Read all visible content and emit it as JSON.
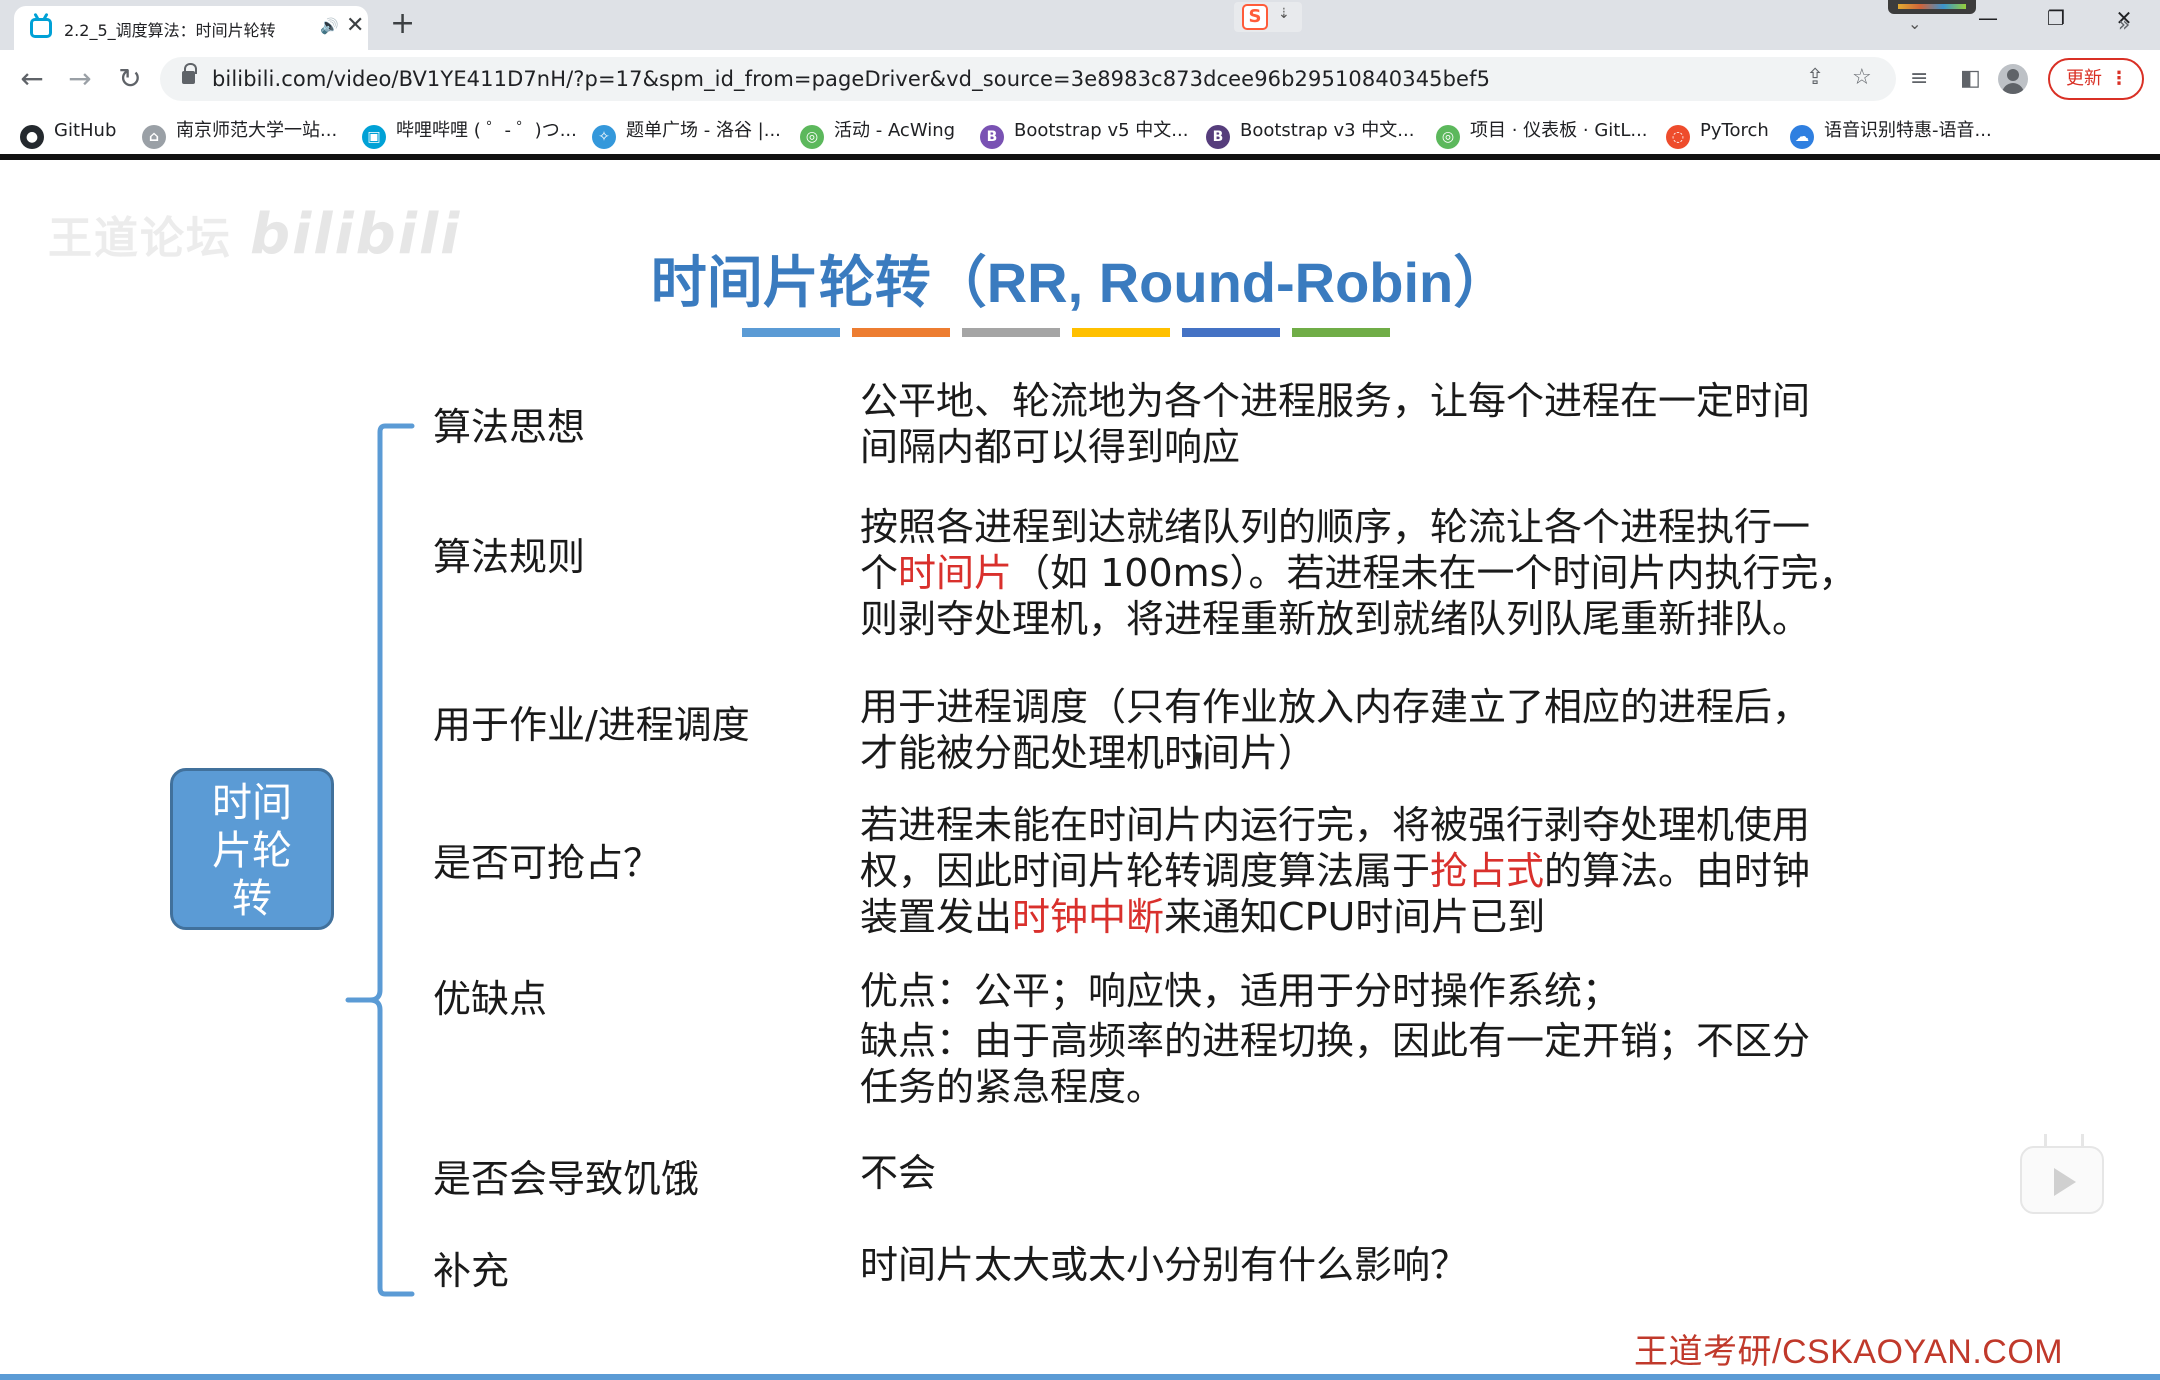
{
  "browser": {
    "tab": {
      "title": "2.2_5_调度算法：时间片轮转",
      "audio_icon": "🔊",
      "close_icon": "✕"
    },
    "new_tab_icon": "+",
    "ext_s_label": "S",
    "window": {
      "minimize": "—",
      "restore": "❐",
      "close": "✕"
    },
    "nav": {
      "back": "←",
      "forward": "→",
      "reload": "↻"
    },
    "url": "bilibili.com/video/BV1YE411D7nH/?p=17&spm_id_from=pageDriver&vd_source=3e8983c873dcee96b29510840345bef5",
    "update_label": "更新",
    "more_menu": "⋮",
    "bookmarks": [
      {
        "label": "GitHub",
        "icon": "github-icon",
        "color": "#24292e",
        "glyph": "●"
      },
      {
        "label": "南京师范大学一站...",
        "icon": "home-icon",
        "color": "#9aa0a6",
        "glyph": "⌂"
      },
      {
        "label": "哔哩哔哩 ( ゜- ゜)つ...",
        "icon": "bilibili-icon",
        "color": "#00a1d6",
        "glyph": "▣"
      },
      {
        "label": "题单广场 - 洛谷 |...",
        "icon": "luogu-icon",
        "color": "#3498db",
        "glyph": "✧"
      },
      {
        "label": "活动 - AcWing",
        "icon": "acwing-icon",
        "color": "#5cb85c",
        "glyph": "◎"
      },
      {
        "label": "Bootstrap v5 中文...",
        "icon": "bootstrap-icon",
        "color": "#7952b3",
        "glyph": "B"
      },
      {
        "label": "Bootstrap v3 中文...",
        "icon": "bootstrap-icon",
        "color": "#563d7c",
        "glyph": "B"
      },
      {
        "label": "项目 · 仪表板 · GitL...",
        "icon": "gitlab-icon",
        "color": "#5cb85c",
        "glyph": "◎"
      },
      {
        "label": "PyTorch",
        "icon": "pytorch-icon",
        "color": "#ee4c2c",
        "glyph": "◌"
      },
      {
        "label": "语音识别特惠-语音...",
        "icon": "cloud-icon",
        "color": "#2f7fe0",
        "glyph": "☁"
      }
    ],
    "bookmarks_more": "»"
  },
  "slide": {
    "watermark": "王道论坛",
    "watermark_logo": "bilibili",
    "title": "时间片轮转（RR, Round-Robin）",
    "title_bar_colors": [
      "#5b9bd5",
      "#ed7d31",
      "#a5a5a5",
      "#ffc000",
      "#4472c4",
      "#70ad47"
    ],
    "center_node": [
      "时间",
      "片轮",
      "转"
    ],
    "rows": [
      {
        "label": "算法思想",
        "desc": [
          "公平地、轮流地为各个进程服务，让每个进程在一定时间",
          "间隔内都可以得到响应"
        ]
      },
      {
        "label": "算法规则",
        "desc": [
          "按照各进程到达就绪队列的顺序，轮流让各个进程执行一",
          "个|时间片|（如 100ms）。若进程未在一个时间片内执行完，",
          "则剥夺处理机，将进程重新放到就绪队列队尾重新排队。"
        ]
      },
      {
        "label": "用于作业/进程调度",
        "desc": [
          "用于进程调度（只有作业放入内存建立了相应的进程后，",
          "才能被分配处理机时间片）"
        ]
      },
      {
        "label": "是否可抢占？",
        "desc": [
          "若进程未能在时间片内运行完，将被强行剥夺处理机使用",
          "权，因此时间片轮转调度算法属于|抢占式|的算法。由时钟",
          "装置发出|时钟中断|来通知CPU时间片已到"
        ]
      },
      {
        "label": "优缺点",
        "desc": [
          "优点：公平；响应快，适用于分时操作系统；",
          "缺点：由于高频率的进程切换，因此有一定开销；不区分",
          "任务的紧急程度。"
        ]
      },
      {
        "label": "是否会导致饥饿",
        "desc": [
          "不会"
        ]
      },
      {
        "label": "补充",
        "desc": [
          "时间片太大或太小分别有什么影响？"
        ]
      }
    ],
    "footer": "王道考研/CSKAOYAN.COM"
  }
}
